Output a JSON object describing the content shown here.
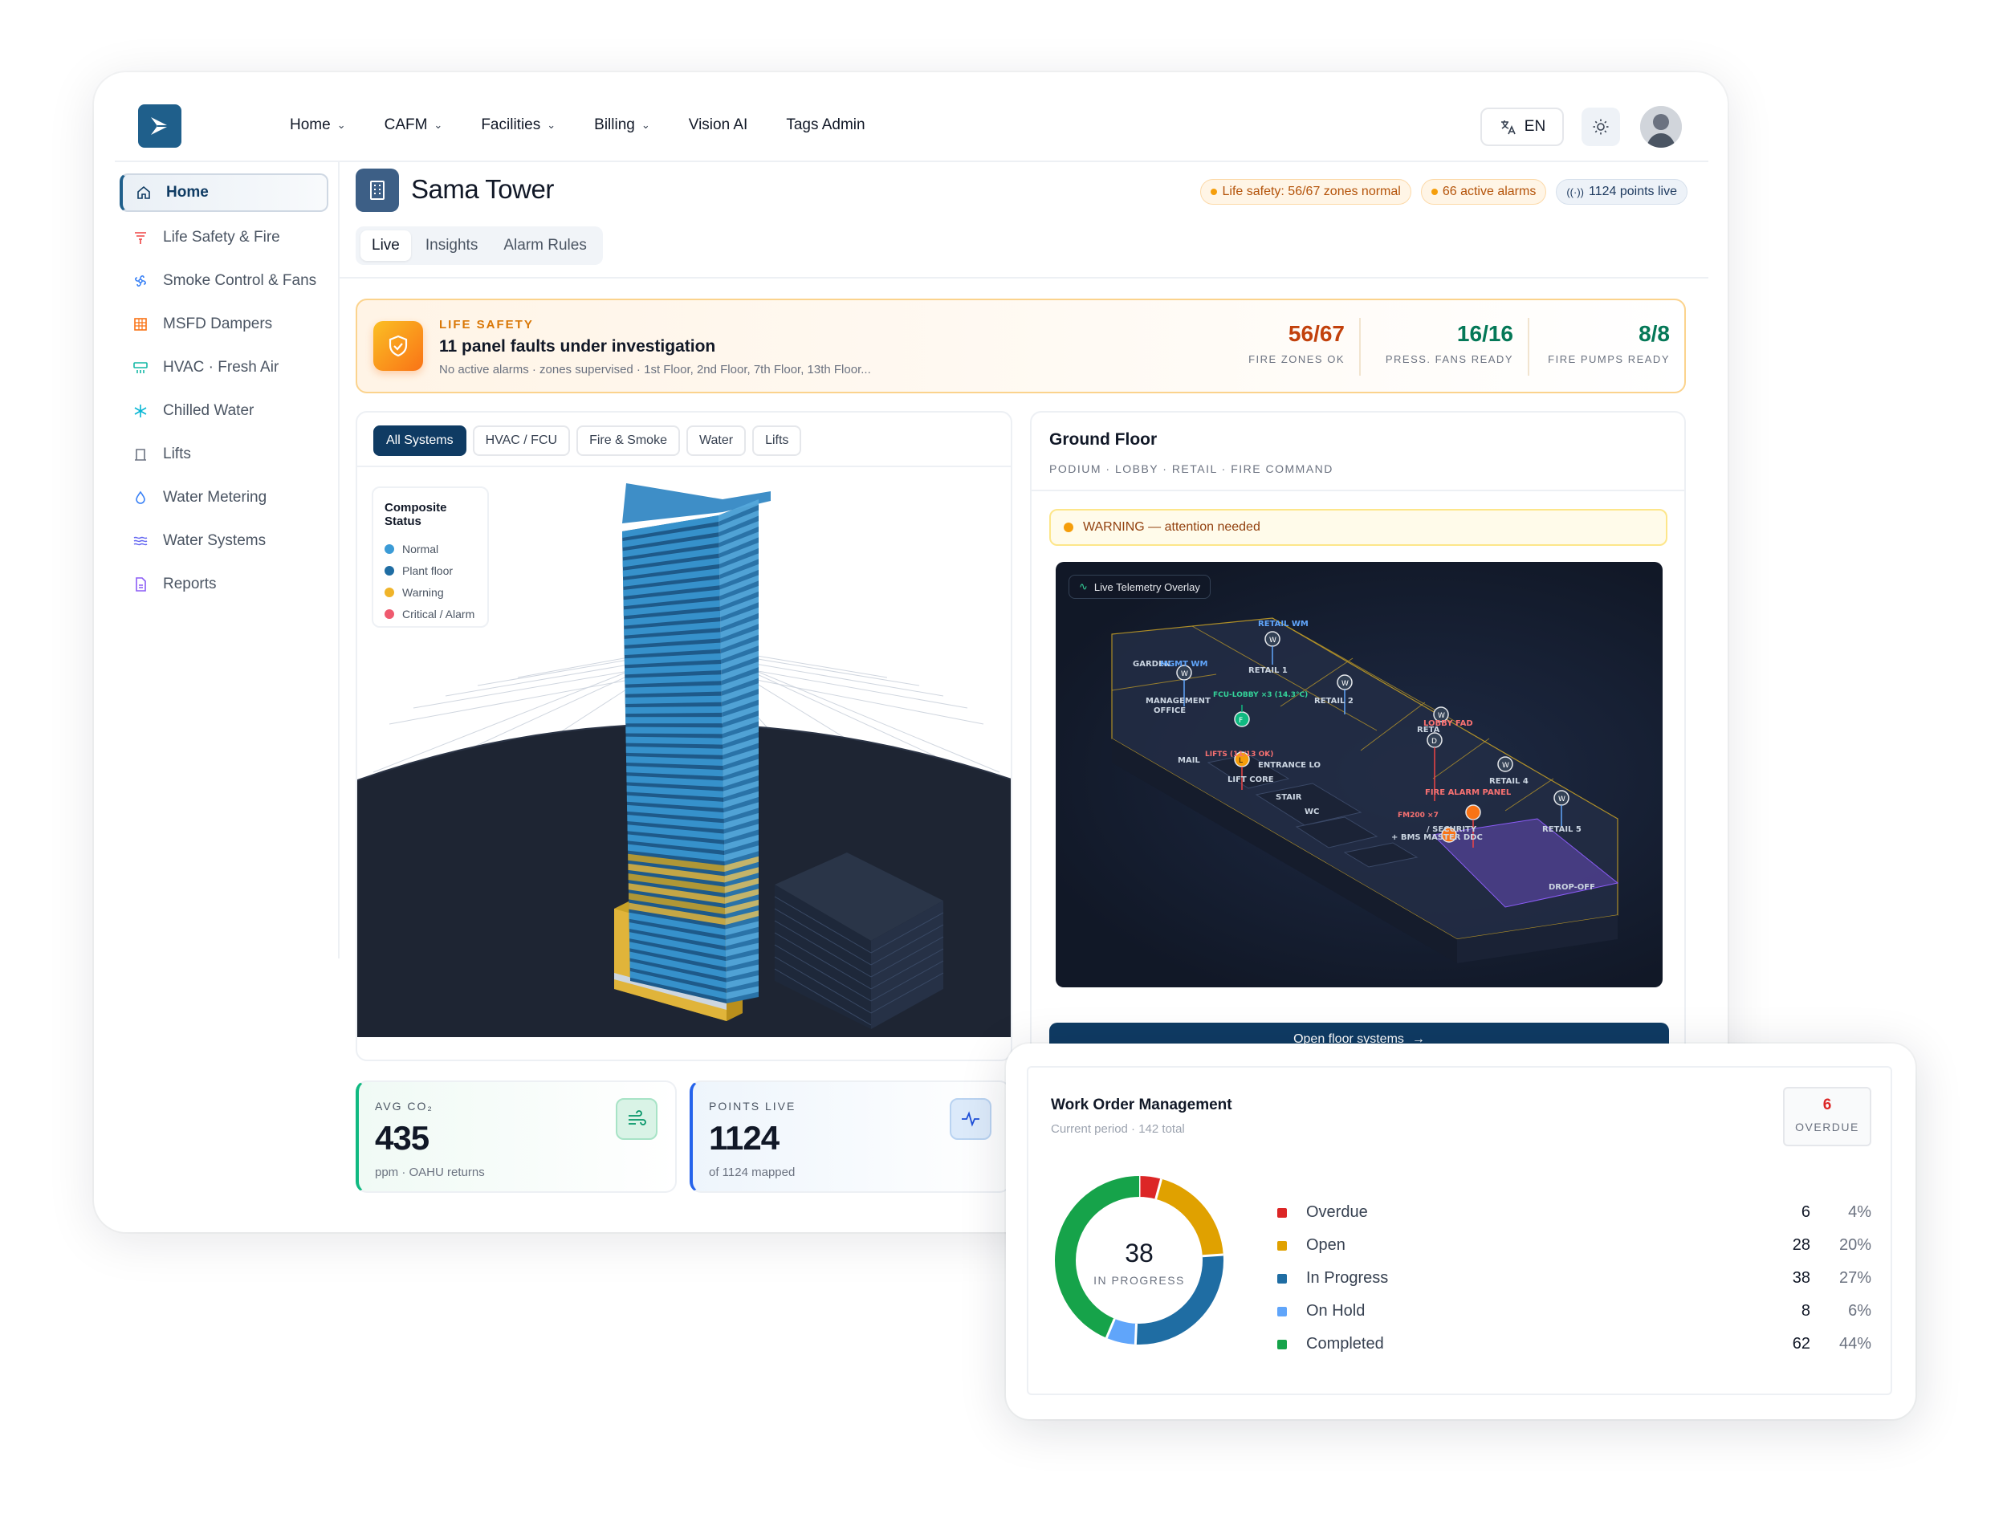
{
  "nav": {
    "items": [
      {
        "label": "Home",
        "has_menu": true
      },
      {
        "label": "CAFM",
        "has_menu": true
      },
      {
        "label": "Facilities",
        "has_menu": true
      },
      {
        "label": "Billing",
        "has_menu": true
      },
      {
        "label": "Vision AI",
        "has_menu": false
      },
      {
        "label": "Tags Admin",
        "has_menu": false
      }
    ],
    "language": "EN"
  },
  "sidebar": {
    "items": [
      {
        "label": "Home",
        "icon": "home-icon",
        "active": true
      },
      {
        "label": "Life Safety & Fire",
        "icon": "fire-icon",
        "color": "#ef4444"
      },
      {
        "label": "Smoke Control & Fans",
        "icon": "fan-icon",
        "color": "#3b82f6"
      },
      {
        "label": "MSFD Dampers",
        "icon": "grid-icon",
        "color": "#f97316"
      },
      {
        "label": "HVAC · Fresh Air",
        "icon": "hvac-icon",
        "color": "#14b8a6"
      },
      {
        "label": "Chilled Water",
        "icon": "snowflake-icon",
        "color": "#06b6d4"
      },
      {
        "label": "Lifts",
        "icon": "lift-icon",
        "color": "#6b7280"
      },
      {
        "label": "Water Metering",
        "icon": "droplet-icon",
        "color": "#3b82f6"
      },
      {
        "label": "Water Systems",
        "icon": "waves-icon",
        "color": "#6366f1"
      },
      {
        "label": "Reports",
        "icon": "report-icon",
        "color": "#8b5cf6"
      }
    ]
  },
  "page": {
    "title": "Sama Tower",
    "tabs": [
      "Live",
      "Insights",
      "Alarm Rules"
    ],
    "pills": [
      {
        "label": "Life safety: 56/67 zones normal",
        "tone": "amber"
      },
      {
        "label": "66 active alarms",
        "tone": "amber"
      },
      {
        "label": "1124 points live",
        "tone": "blue"
      }
    ]
  },
  "banner": {
    "kicker": "LIFE SAFETY",
    "title": "11 panel faults under investigation",
    "subtitle": "No active alarms · zones supervised · 1st Floor, 2nd Floor, 7th Floor, 13th Floor...",
    "stats": [
      {
        "value": "56/67",
        "label": "FIRE ZONES OK",
        "color": "#c2410c"
      },
      {
        "value": "16/16",
        "label": "PRESS. FANS READY",
        "color": "#047857"
      },
      {
        "value": "8/8",
        "label": "FIRE PUMPS READY",
        "color": "#047857"
      }
    ]
  },
  "scene": {
    "filters": [
      "All Systems",
      "HVAC / FCU",
      "Fire & Smoke",
      "Water",
      "Lifts"
    ],
    "legend_title": "Composite Status",
    "legend": [
      {
        "label": "Normal",
        "color": "#3b9bd6"
      },
      {
        "label": "Plant floor",
        "color": "#1f6da3"
      },
      {
        "label": "Warning",
        "color": "#f0b429"
      },
      {
        "label": "Critical / Alarm",
        "color": "#ef5a6f"
      }
    ]
  },
  "floor": {
    "title": "Ground Floor",
    "subtitle": "PODIUM · LOBBY · RETAIL · FIRE COMMAND",
    "warning": "WARNING — attention needed",
    "overlay_label": "Live Telemetry Overlay",
    "labels": {
      "retail_wm": "RETAIL WM",
      "garden": "GARDEN",
      "mgmt_wm": "MGMT WM",
      "retail1": "RETAIL 1",
      "retail2": "RETAIL 2",
      "retail3": "RETA",
      "retail4": "RETAIL 4",
      "retail5": "RETAIL 5",
      "mgmt_office_1": "MANAGEMENT",
      "mgmt_office_2": "OFFICE",
      "fcu_lobby": "FCU-LOBBY ×3 (14.3°C)",
      "lobby_fad": "LOBBY FAD",
      "lifts": "LIFTS (11/13 OK)",
      "entrance": "ENTRANCE LO",
      "mail": "MAIL",
      "lift_core": "LIFT CORE",
      "fire_alarm_panel": "FIRE ALARM PANEL",
      "stair": "STAIR",
      "wc": "WC",
      "fm200": "FM200 ×7",
      "security": "/ SECURITY",
      "bms": "+ BMS MASTER DDC",
      "dropoff": "DROP-OFF"
    },
    "button": "Open floor systems"
  },
  "metrics": [
    {
      "key": "AVG CO₂",
      "value": "435",
      "sub": "ppm · OAHU returns",
      "icon": "wind-icon"
    },
    {
      "key": "POINTS LIVE",
      "value": "1124",
      "sub": "of 1124 mapped",
      "icon": "pulse-icon"
    }
  ],
  "work_orders": {
    "title": "Work Order Management",
    "subtitle": "Current period · 142 total",
    "overdue_count": "6",
    "overdue_label": "OVERDUE",
    "center_value": "38",
    "center_label": "IN PROGRESS",
    "rows": [
      {
        "label": "Overdue",
        "count": "6",
        "pct": "4%",
        "color": "#dc2626"
      },
      {
        "label": "Open",
        "count": "28",
        "pct": "20%",
        "color": "#e0a100"
      },
      {
        "label": "In Progress",
        "count": "38",
        "pct": "27%",
        "color": "#1f6da3"
      },
      {
        "label": "On Hold",
        "count": "8",
        "pct": "6%",
        "color": "#60a5fa"
      },
      {
        "label": "Completed",
        "count": "62",
        "pct": "44%",
        "color": "#16a34a"
      }
    ]
  },
  "colors": {
    "brand": "#1f5f8b",
    "navy": "#0f3b63",
    "amber": "#d97706"
  }
}
